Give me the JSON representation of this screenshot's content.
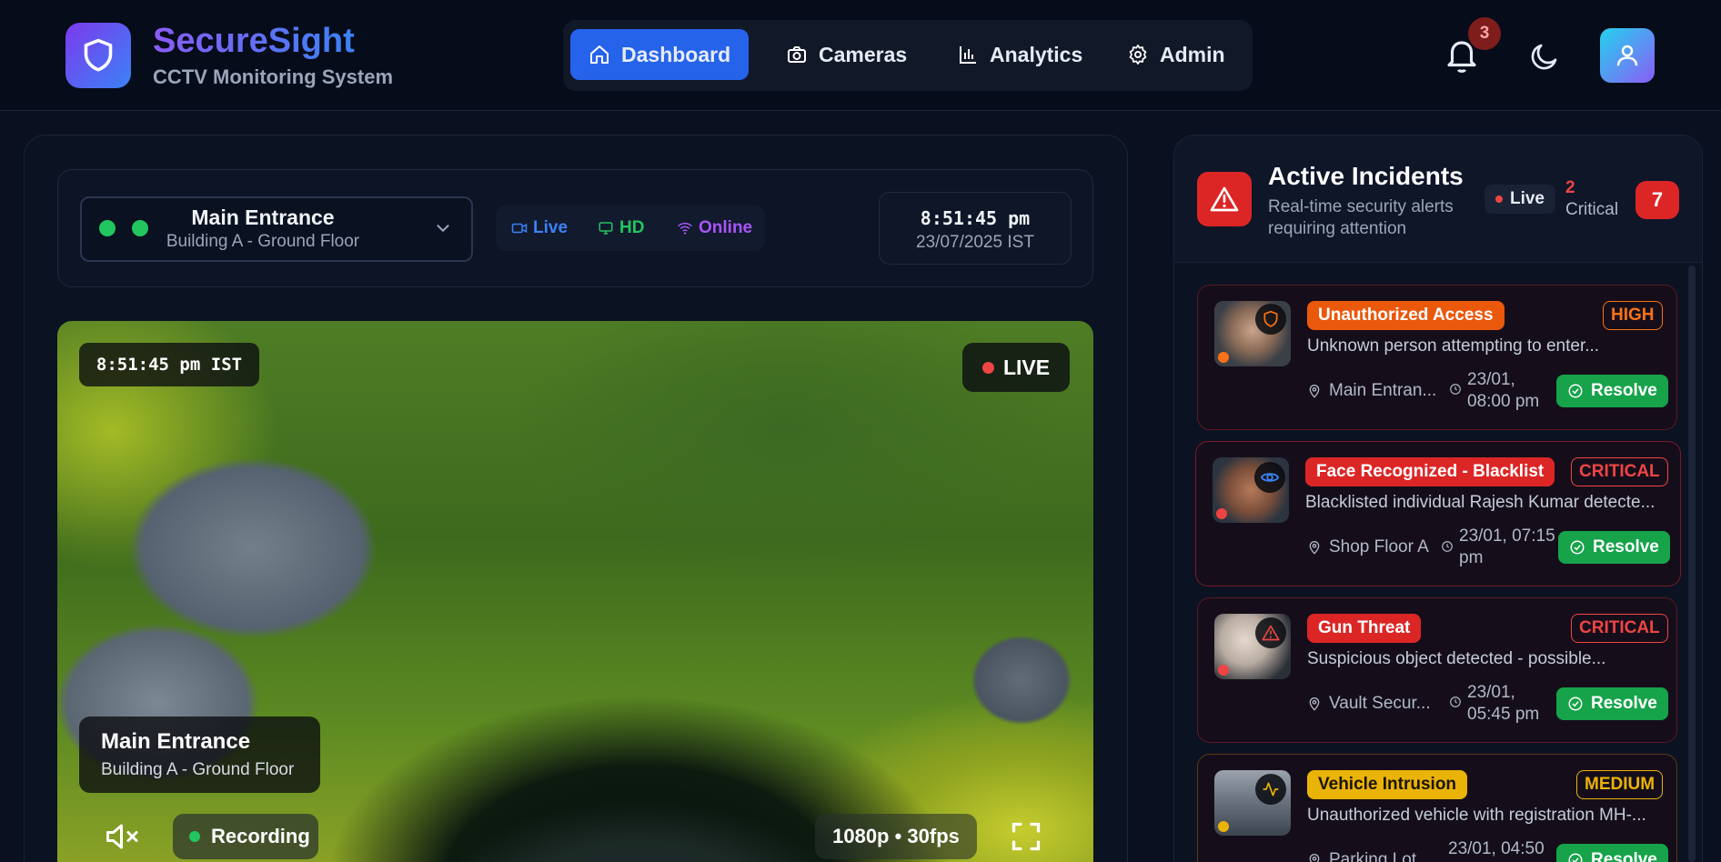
{
  "app": {
    "name": "SecureSight",
    "subtitle": "CCTV Monitoring System"
  },
  "nav": {
    "items": [
      {
        "label": "Dashboard",
        "icon": "home-icon",
        "active": true
      },
      {
        "label": "Cameras",
        "icon": "camera-icon",
        "active": false
      },
      {
        "label": "Analytics",
        "icon": "bar-chart-icon",
        "active": false
      },
      {
        "label": "Admin",
        "icon": "gear-icon",
        "active": false
      }
    ]
  },
  "header_actions": {
    "notification_count": "3",
    "theme_icon": "moon-icon",
    "user_icon": "user-icon"
  },
  "camera_selector": {
    "name": "Main Entrance",
    "location": "Building A - Ground Floor"
  },
  "status_pills": {
    "live": "Live",
    "hd": "HD",
    "online": "Online"
  },
  "clock": {
    "time": "8:51:45 pm",
    "date": "23/07/2025 IST"
  },
  "video": {
    "timestamp": "8:51:45 pm IST",
    "live_label": "LIVE",
    "caption_title": "Main Entrance",
    "caption_sub": "Building A - Ground Floor",
    "recording_label": "Recording",
    "resolution": "1080p • 30fps"
  },
  "incidents": {
    "title": "Active Incidents",
    "subtitle": "Real-time security alerts requiring attention",
    "live_label": "Live",
    "critical_count": "2",
    "critical_label": "Critical",
    "total": "7",
    "resolve_label": "Resolve",
    "items": [
      {
        "type": "Unauthorized Access",
        "severity": "HIGH",
        "description": "Unknown person attempting to enter...",
        "location": "Main Entran...",
        "time_line1": "23/01,",
        "time_line2": "08:00 pm",
        "type_color": "#ea580c",
        "severity_color": "#f97316",
        "icon": "shield-icon"
      },
      {
        "type": "Face Recognized - Blacklist",
        "severity": "CRITICAL",
        "description": "Blacklisted individual Rajesh Kumar detecte...",
        "location": "Shop Floor A",
        "time_line1": "23/01, 07:15",
        "time_line2": "pm",
        "type_color": "#dc2626",
        "severity_color": "#ef4444",
        "icon": "eye-icon"
      },
      {
        "type": "Gun Threat",
        "severity": "CRITICAL",
        "description": "Suspicious object detected - possible...",
        "location": "Vault Secur...",
        "time_line1": "23/01,",
        "time_line2": "05:45 pm",
        "type_color": "#dc2626",
        "severity_color": "#ef4444",
        "icon": "warning-icon"
      },
      {
        "type": "Vehicle Intrusion",
        "severity": "MEDIUM",
        "description": "Unauthorized vehicle with registration MH-...",
        "location": "Parking Lot",
        "time_line1": "23/01, 04:50",
        "time_line2": "",
        "type_color": "#eab308",
        "severity_color": "#eab308",
        "icon": "activity-icon"
      }
    ]
  },
  "colors": {
    "accent": "#2563eb",
    "critical": "#dc2626",
    "success": "#16a34a"
  }
}
